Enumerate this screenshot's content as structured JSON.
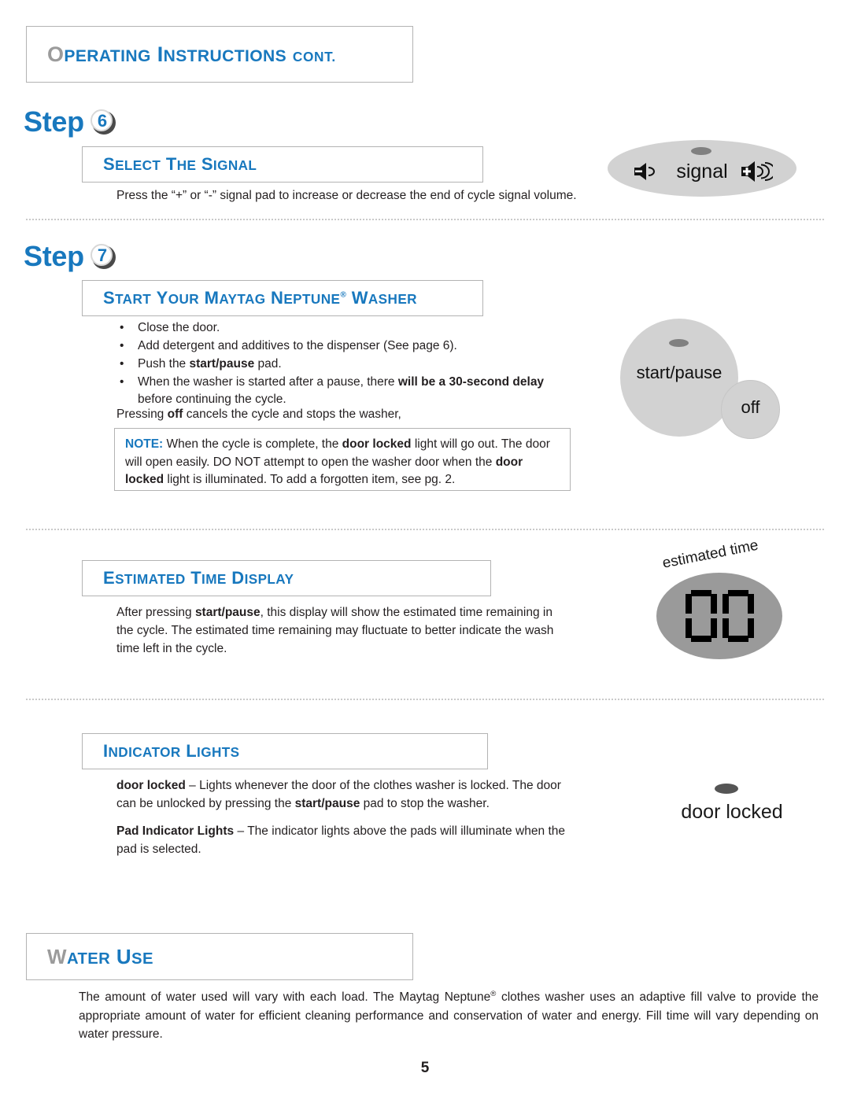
{
  "header": {
    "title_cap_o": "O",
    "title_rest_1": "PERATING",
    "title_cap_i": "I",
    "title_rest_2": "NSTRUCTIONS",
    "title_cont": "CONT."
  },
  "steps": {
    "step6": {
      "word": "Step",
      "number": "6"
    },
    "step7": {
      "word": "Step",
      "number": "7"
    }
  },
  "sections": {
    "select_signal": {
      "title_parts": [
        "S",
        "ELECT",
        "T",
        "HE",
        "S",
        "IGNAL"
      ],
      "body": "Press the “+” or “-” signal pad to increase or decrease the end of cycle signal volume."
    },
    "start_washer": {
      "title_parts": [
        "S",
        "TART",
        "Y",
        "OUR",
        "M",
        "AYTAG",
        "N",
        "EPTUNE",
        "W",
        "ASHER"
      ],
      "trademark": "®",
      "bullets": [
        {
          "pre": "Close the door.",
          "bold": "",
          "post": ""
        },
        {
          "pre": "Add detergent and additives to the dispenser (See page 6).",
          "bold": "",
          "post": ""
        },
        {
          "pre": "Push the ",
          "bold": "start/pause",
          "post": " pad."
        },
        {
          "pre": "When the washer is started after a pause, there ",
          "bold": "will be a 30-second delay",
          "post": " before continuing the cycle."
        }
      ],
      "pressing_off": {
        "pre": "Pressing ",
        "bold": "off",
        "post": " cancels the cycle and stops the washer,"
      },
      "note": {
        "label": "NOTE:",
        "t1": " When the cycle is complete, the ",
        "b1": "door locked",
        "t2": " light will go out. The door will open easily. DO NOT attempt to open the washer door when the ",
        "b2": "door locked",
        "t3": " light is illuminated. To add a forgotten item, see pg. 2."
      }
    },
    "estimated_time": {
      "title_parts": [
        "E",
        "STIMATED",
        "T",
        "IME",
        "D",
        "ISPLAY"
      ],
      "body": {
        "pre": "After pressing ",
        "bold": "start/pause",
        "post": ", this display will show the estimated time remaining in the cycle. The estimated time remaining may fluctuate to better indicate the wash time left in the cycle."
      }
    },
    "indicator_lights": {
      "title_parts": [
        "I",
        "NDICATOR",
        "L",
        "IGHTS"
      ],
      "para1": {
        "bold": "door locked",
        "t1": " – Lights whenever the door of the clothes washer is locked. The door can be unlocked by pressing the ",
        "b2": "start/pause",
        "t2": " pad to stop the washer."
      },
      "para2": {
        "bold": "Pad Indicator Lights",
        "text": " – The indicator lights above the pads will illuminate when the pad is selected."
      }
    },
    "water_use": {
      "title_parts": [
        "W",
        "ATER",
        "U",
        "SE"
      ],
      "body_1": "The amount of water used will vary with each load. The Maytag Neptune",
      "body_reg": "®",
      "body_2": " clothes washer uses an adaptive fill valve to provide the appropriate amount of water for efficient cleaning performance and conservation of water and energy. Fill time will vary depending on water pressure."
    }
  },
  "graphics": {
    "signal_pad": {
      "label": "signal",
      "icon_left": "speaker-minus-icon",
      "icon_right": "speaker-plus-icon",
      "led": "indicator-led"
    },
    "start_pause_pad": {
      "label": "start/pause",
      "off_label": "off",
      "led": "indicator-led"
    },
    "estimated_time_display": {
      "label": "estimated time",
      "value": "00"
    },
    "door_locked_light": {
      "label": "door locked",
      "led": "indicator-led"
    }
  },
  "footer": {
    "page_number": "5"
  },
  "colors": {
    "heading_blue": "#1878be",
    "gray_cap": "#9b9b9b",
    "box_border": "#b3b3b3",
    "pad_gray": "#d2d2d2",
    "display_gray": "#9a9a9a",
    "led_gray": "#808080"
  }
}
